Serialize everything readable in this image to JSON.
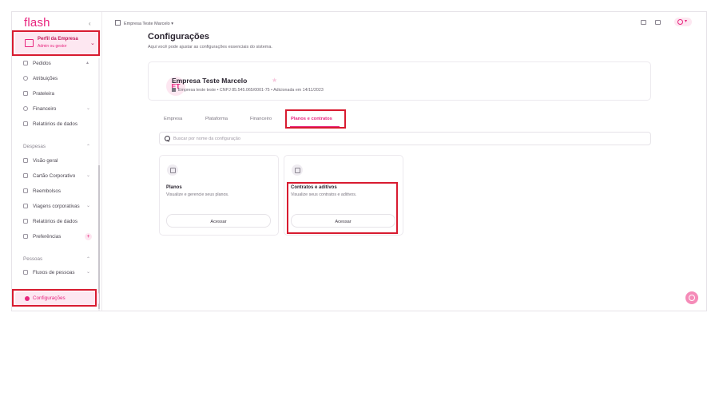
{
  "sidebar": {
    "logo": "flash",
    "profile": {
      "title": "Perfil da Empresa",
      "subtitle": "Admin ou gestor"
    },
    "items_top": [
      {
        "label": "Pedidos",
        "icon": "cart-icon",
        "chevron": ""
      },
      {
        "label": "Atribuições",
        "icon": "user-icon",
        "chevron": ""
      },
      {
        "label": "Prateleira",
        "icon": "grid-icon",
        "chevron": ""
      },
      {
        "label": "Financeiro",
        "icon": "coin-icon",
        "chevron": "⌄"
      },
      {
        "label": "Relatórios de dados",
        "icon": "report-icon",
        "chevron": ""
      }
    ],
    "section_despesas": "Despesas",
    "items_despesas": [
      {
        "label": "Visão geral",
        "icon": "chart-icon",
        "chevron": ""
      },
      {
        "label": "Cartão Corporativo",
        "icon": "card-icon",
        "chevron": "⌄"
      },
      {
        "label": "Reembolsos",
        "icon": "receipt-icon",
        "chevron": ""
      },
      {
        "label": "Viagens corporativas",
        "icon": "plane-icon",
        "chevron": "⌄"
      },
      {
        "label": "Relatórios de dados",
        "icon": "report-icon",
        "chevron": ""
      },
      {
        "label": "Preferências",
        "icon": "sliders-icon",
        "chevron": ""
      }
    ],
    "section_pessoas": "Pessoas",
    "items_pessoas": [
      {
        "label": "Fluxos de pessoas",
        "icon": "flow-icon",
        "chevron": "⌄"
      }
    ],
    "config_label": "Configurações"
  },
  "topbar": {
    "company": "Empresa Teste Marcelo"
  },
  "header": {
    "title": "Configurações",
    "subtitle": "Aqui você pode ajustar as configurações essenciais do sistema."
  },
  "company_card": {
    "initials": "ET",
    "name": "Empresa Teste Marcelo",
    "info": "Empresa teste teste  •  CNPJ 85.545.065/0001-75  •  Adicionada em 14/11/2023"
  },
  "tabs": [
    "Empresa",
    "Plataforma",
    "Financeiro",
    "Planos e contratos"
  ],
  "search": {
    "placeholder": "Buscar por nome da configuração"
  },
  "cards": [
    {
      "title": "Planos",
      "description": "Visualize e gerencie seus planos.",
      "button": "Acessar",
      "icon": "plans-icon"
    },
    {
      "title": "Contratos e aditivos",
      "description": "Visualize seus contratos e aditivos.",
      "button": "Acessar",
      "icon": "contract-icon"
    }
  ],
  "colors": {
    "accent": "#e8247e",
    "accent_soft": "#fde7f1",
    "highlight": "#d81b30"
  }
}
